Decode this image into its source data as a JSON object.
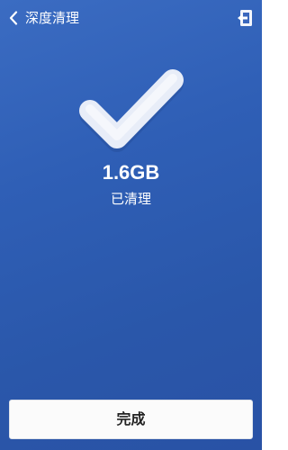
{
  "header": {
    "title": "深度清理",
    "back_icon": "chevron-left-icon",
    "exit_icon": "exit-icon"
  },
  "result": {
    "icon": "checkmark-icon",
    "cleaned_size": "1.6GB",
    "status": "已清理"
  },
  "footer": {
    "done_label": "完成"
  },
  "colors": {
    "background": "#2f5fb6",
    "button_bg": "#fbfbfb",
    "text_light": "#ffffff"
  }
}
